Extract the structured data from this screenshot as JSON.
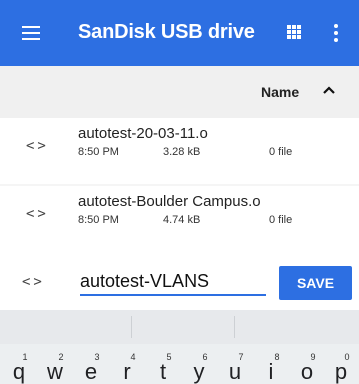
{
  "appbar": {
    "title": "SanDisk USB drive",
    "icons": [
      "menu-icon",
      "grid-view-icon",
      "more-vert-icon"
    ]
  },
  "columns": {
    "name_label": "Name",
    "sort_icon": "chevron-up-icon"
  },
  "files": [
    {
      "icon": "code-icon",
      "icon_text": "<>",
      "name": "autotest-20-03-11.o",
      "time": "8:50 PM",
      "size": "3.28 kB",
      "info": "0 file"
    },
    {
      "icon": "code-icon",
      "icon_text": "<>",
      "name": "autotest-Boulder Campus.o",
      "time": "8:50 PM",
      "size": "4.74 kB",
      "info": "0 file"
    }
  ],
  "rename": {
    "icon_text": "<>",
    "value": "autotest-VLANS",
    "save_label": "SAVE"
  },
  "keyboard": {
    "keys": [
      {
        "num": "1",
        "ch": "q"
      },
      {
        "num": "2",
        "ch": "w"
      },
      {
        "num": "3",
        "ch": "e"
      },
      {
        "num": "4",
        "ch": "r"
      },
      {
        "num": "5",
        "ch": "t"
      },
      {
        "num": "6",
        "ch": "y"
      },
      {
        "num": "7",
        "ch": "u"
      },
      {
        "num": "8",
        "ch": "i"
      },
      {
        "num": "9",
        "ch": "o"
      },
      {
        "num": "0",
        "ch": "p"
      }
    ]
  },
  "colors": {
    "accent": "#2d6fe2",
    "header_bg": "#f0f0f0",
    "keyboard_bg": "#eceff1"
  }
}
